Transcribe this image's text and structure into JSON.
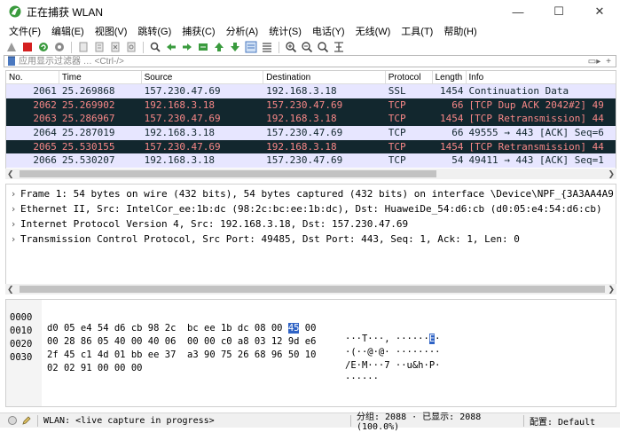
{
  "window": {
    "title": "正在捕获 WLAN",
    "controls": [
      "—",
      "☐",
      "✕"
    ]
  },
  "menu": [
    "文件(F)",
    "编辑(E)",
    "视图(V)",
    "跳转(G)",
    "捕获(C)",
    "分析(A)",
    "统计(S)",
    "电话(Y)",
    "无线(W)",
    "工具(T)",
    "帮助(H)"
  ],
  "toolbar": {
    "icons": [
      "shark-fin-icon",
      "stop-icon",
      "restart-icon",
      "options-gear-icon",
      "open-file-icon",
      "save-file-icon",
      "close-file-icon",
      "reload-icon",
      "find-icon",
      "back-arrow-icon",
      "forward-arrow-icon",
      "goto-packet-icon",
      "first-packet-icon",
      "last-packet-icon",
      "autoscroll-icon",
      "colorize-icon",
      "zoom-in-icon",
      "zoom-out-icon",
      "zoom-normal-icon",
      "resize-columns-icon"
    ]
  },
  "filter": {
    "placeholder": "应用显示过滤器 … <Ctrl-/>",
    "apply_label": "▭▸",
    "add_label": "+"
  },
  "packet_list": {
    "columns": [
      "No.",
      "Time",
      "Source",
      "Destination",
      "Protocol",
      "Length",
      "Info"
    ],
    "rows": [
      {
        "no": "2061",
        "time": "25.269868",
        "src": "157.230.47.69",
        "dst": "192.168.3.18",
        "proto": "SSL",
        "len": "1454",
        "info": "Continuation Data",
        "style": "light"
      },
      {
        "no": "2062",
        "time": "25.269902",
        "src": "192.168.3.18",
        "dst": "157.230.47.69",
        "proto": "TCP",
        "len": "66",
        "info": "[TCP Dup ACK 2042#2] 49",
        "style": "dark"
      },
      {
        "no": "2063",
        "time": "25.286967",
        "src": "157.230.47.69",
        "dst": "192.168.3.18",
        "proto": "TCP",
        "len": "1454",
        "info": "[TCP Retransmission] 44",
        "style": "dark"
      },
      {
        "no": "2064",
        "time": "25.287019",
        "src": "192.168.3.18",
        "dst": "157.230.47.69",
        "proto": "TCP",
        "len": "66",
        "info": "49555 → 443 [ACK] Seq=6",
        "style": "light"
      },
      {
        "no": "2065",
        "time": "25.530155",
        "src": "157.230.47.69",
        "dst": "192.168.3.18",
        "proto": "TCP",
        "len": "1454",
        "info": "[TCP Retransmission] 44",
        "style": "dark"
      },
      {
        "no": "2066",
        "time": "25.530207",
        "src": "192.168.3.18",
        "dst": "157.230.47.69",
        "proto": "TCP",
        "len": "54",
        "info": "49411 → 443 [ACK] Seq=1",
        "style": "light"
      }
    ]
  },
  "details": [
    "Frame 1: 54 bytes on wire (432 bits), 54 bytes captured (432 bits) on interface \\Device\\NPF_{3A3AA4A9",
    "Ethernet II, Src: IntelCor_ee:1b:dc (98:2c:bc:ee:1b:dc), Dst: HuaweiDe_54:d6:cb (d0:05:e4:54:d6:cb)",
    "Internet Protocol Version 4, Src: 192.168.3.18, Dst: 157.230.47.69",
    "Transmission Control Protocol, Src Port: 49485, Dst Port: 443, Seq: 1, Ack: 1, Len: 0"
  ],
  "bytes": [
    {
      "offset": "0000",
      "hex_a": "d0 05 e4 54 d6 cb 98 2c  bc ee 1b dc 08 00 ",
      "hex_hl": "45",
      "hex_b": " 00",
      "ascii_a": "···T···, ······",
      "ascii_hl": "E",
      "ascii_b": "·"
    },
    {
      "offset": "0010",
      "hex_a": "00 28 86 05 40 00 40 06  00 00 c0 a8 03 12 9d e6",
      "hex_hl": "",
      "hex_b": "",
      "ascii_a": "·(··@·@· ········",
      "ascii_hl": "",
      "ascii_b": ""
    },
    {
      "offset": "0020",
      "hex_a": "2f 45 c1 4d 01 bb ee 37  a3 90 75 26 68 96 50 10",
      "hex_hl": "",
      "hex_b": "",
      "ascii_a": "/E·M···7 ··u&h·P·",
      "ascii_hl": "",
      "ascii_b": ""
    },
    {
      "offset": "0030",
      "hex_a": "02 02 91 00 00 00",
      "hex_hl": "",
      "hex_b": "",
      "ascii_a": "······",
      "ascii_hl": "",
      "ascii_b": ""
    }
  ],
  "status": {
    "interface": "WLAN: <live capture in progress>",
    "packets": "分组: 2088 · 已显示: 2088 (100.0%)",
    "profile": "配置: Default"
  },
  "colors": {
    "row_light_bg": "#e7e6ff",
    "row_dark_bg": "#12272e",
    "row_dark_fg": "#f78787",
    "byte_highlight": "#2f63c5"
  }
}
